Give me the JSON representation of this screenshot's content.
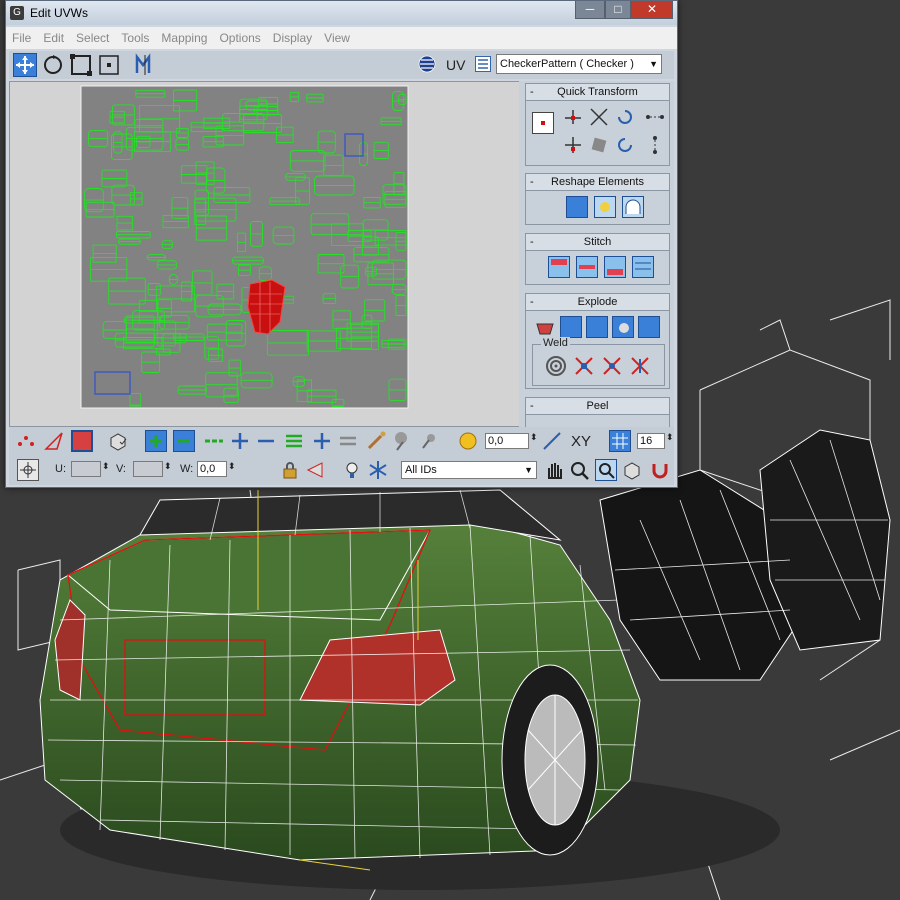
{
  "window": {
    "title": "Edit UVWs",
    "minimize": "─",
    "maximize": "□",
    "close": "✕"
  },
  "menu": [
    "File",
    "Edit",
    "Select",
    "Tools",
    "Mapping",
    "Options",
    "Display",
    "View"
  ],
  "toolbar": {
    "uv_label": "UV",
    "texture_select": "CheckerPattern  ( Checker )"
  },
  "panel": {
    "quick_transform": "Quick Transform",
    "reshape_elements": "Reshape Elements",
    "stitch": "Stitch",
    "explode": "Explode",
    "weld": "Weld",
    "peel": "Peel",
    "minus": "-"
  },
  "bottom": {
    "spinner_value": "0,0",
    "xy_label": "XY",
    "grid_value": "16",
    "u_label": "U:",
    "v_label": "V:",
    "w_label": "W:",
    "w_value": "0,0",
    "id_select": "All IDs"
  },
  "colors": {
    "uv_wire": "#26e026",
    "uv_selected": "#e01010",
    "uv_bg": "#808080",
    "car_paint": "#3f6a2c",
    "wire": "#ffffff"
  },
  "icons": [
    "move-icon",
    "rotate-icon",
    "scale-icon",
    "freeform-icon",
    "mirror-icon",
    "globe-icon",
    "checker-icon",
    "snap-icon",
    "pan-icon",
    "zoom-icon",
    "magnet-icon",
    "lock-icon",
    "snowflake-icon"
  ]
}
